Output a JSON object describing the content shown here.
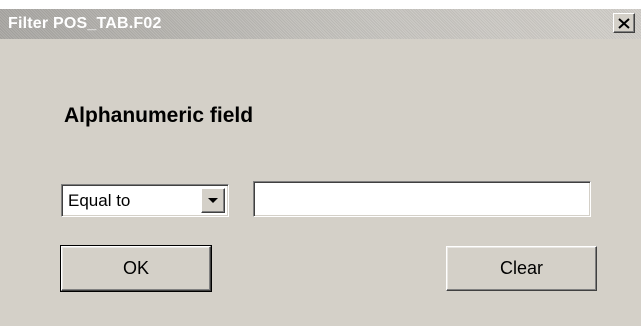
{
  "window": {
    "title": "Filter POS_TAB.F02",
    "close_label": "X"
  },
  "form": {
    "heading": "Alphanumeric field",
    "operator": {
      "selected": "Equal to",
      "icon": "chevron-down-icon"
    },
    "value_input": {
      "value": "",
      "placeholder": ""
    }
  },
  "buttons": {
    "ok_label": "OK",
    "clear_label": "Clear"
  },
  "colors": {
    "dialog_bg": "#d4d0c8",
    "title_text": "#ffffff",
    "input_bg": "#ffffff"
  }
}
